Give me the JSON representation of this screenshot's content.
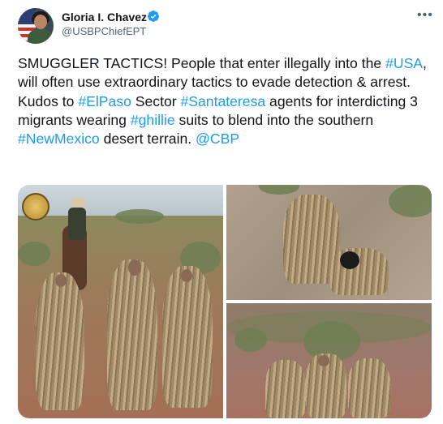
{
  "author": {
    "name": "Gloria I. Chavez",
    "handle": "@USBPChiefEPT",
    "verified": true
  },
  "menu_icon": "more-horizontal-icon",
  "tweet": {
    "parts": [
      {
        "t": "SMUGGLER TACTICS! People that enter illegally into the ",
        "tag": false
      },
      {
        "t": "#USA",
        "tag": true
      },
      {
        "t": ", will often use extraordinary tactics to evade detection & arrest. Kudos to ",
        "tag": false
      },
      {
        "t": "#ElPaso",
        "tag": true
      },
      {
        "t": " Sector ",
        "tag": false
      },
      {
        "t": "#Santateresa",
        "tag": true
      },
      {
        "t": " agents for interdicting 3 migrants wearing ",
        "tag": false
      },
      {
        "t": "#ghillie",
        "tag": true
      },
      {
        "t": " suits to blend into the southern ",
        "tag": false
      },
      {
        "t": "#NewMexico",
        "tag": true
      },
      {
        "t": " desert terrain. ",
        "tag": false
      },
      {
        "t": "@CBP",
        "tag": true
      }
    ]
  },
  "colors": {
    "link": "#1d9bf0",
    "text": "#0f1419",
    "secondary": "#536471",
    "verified": "#1d9bf0"
  },
  "media": {
    "count": 3
  }
}
